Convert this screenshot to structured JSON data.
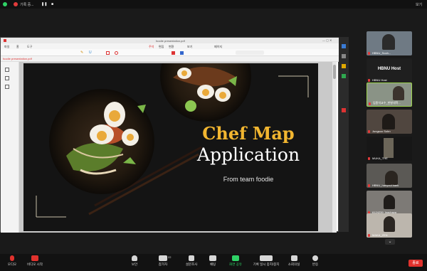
{
  "topbar": {
    "title": "기록 중...",
    "view_label": "보기"
  },
  "ppt": {
    "title": "foodie presentation.pdf",
    "menu": [
      "파일",
      "홈",
      "도구",
      "주석",
      "편집",
      "변환",
      "보기",
      "페이지"
    ],
    "tab_label": "foodie presentation.pdf"
  },
  "slide": {
    "title_line1": "Chef Map",
    "title_line2": "Application",
    "subtitle": "From team foodie"
  },
  "gallery": [
    {
      "name": "HBNU_Sooh..."
    },
    {
      "name": "HBNU Host"
    },
    {
      "name": "HBNU Host",
      "plain": true
    },
    {
      "name": "임종석교수_한발대학..."
    },
    {
      "name": "Jungsoo Sohn"
    },
    {
      "name": "MUKA_THE"
    },
    {
      "name": "HBNU_hanyoul baek"
    },
    {
      "name": "6124239_Inachaya"
    },
    {
      "name": "MAKA_ZEN"
    }
  ],
  "bottom": [
    {
      "label": "오디오"
    },
    {
      "label": "비디오 시작"
    },
    {
      "label": "보안"
    },
    {
      "label": "참가자",
      "count": "22"
    },
    {
      "label": "설문조사"
    },
    {
      "label": "채팅"
    },
    {
      "label": "화면 공유"
    },
    {
      "label": "기록 일시 중지/중지"
    },
    {
      "label": "소회의실"
    },
    {
      "label": "반응"
    }
  ],
  "end_label": "종료",
  "colors": {
    "accent_gold": "#f2b630",
    "share_green": "#2fd266",
    "end_red": "#e0322d"
  }
}
